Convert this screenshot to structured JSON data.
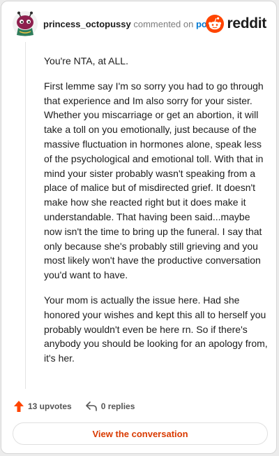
{
  "header": {
    "username": "princess_octopussy",
    "verb": "commented on",
    "post_link": "post",
    "brand": "reddit"
  },
  "comment": {
    "paragraphs": [
      "You're NTA, at ALL.",
      "First lemme say I'm so sorry you had to go through that experience and Im also sorry for your sister. Whether you miscarriage or get an abortion, it will take a toll on you emotionally, just because of the massive fluctuation in hormones alone, speak less of the psychological and emotional toll. With that in mind your sister probably wasn't speaking from a place of malice but of misdirected grief. It doesn't make how she reacted right but it does make it understandable. That having been said...maybe now isn't the time to bring up the funeral. I say that only because she's probably still grieving and you most likely won't have the productive conversation you'd want to have.",
      "Your mom is actually the issue here. Had she honored your wishes and kept this all to herself you probably wouldn't even be here rn. So if there's anybody you should be looking for an apology from, it's her."
    ]
  },
  "stats": {
    "upvotes": "13 upvotes",
    "replies": "0 replies"
  },
  "cta": {
    "label": "View the conversation"
  },
  "colors": {
    "brand_orange": "#ff4500",
    "link_blue": "#0079d3",
    "cta_text": "#d93a00",
    "upvote_arrow": "#ff4500"
  }
}
